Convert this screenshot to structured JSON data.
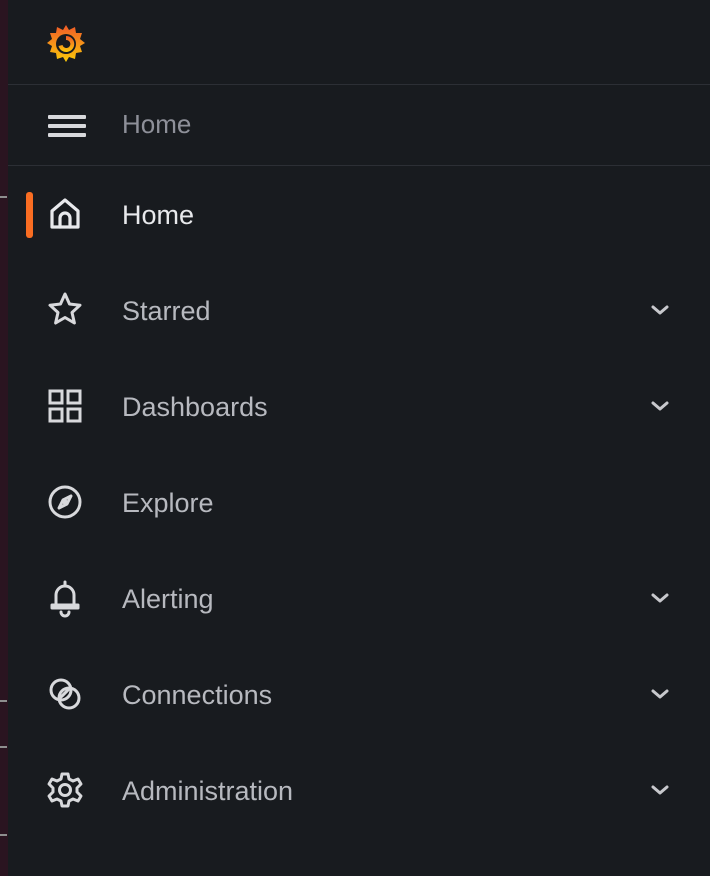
{
  "header": {
    "logo_icon": "grafana-logo"
  },
  "dock": {
    "menu_icon": "hamburger-menu-icon",
    "title": "Home"
  },
  "nav": {
    "items": [
      {
        "label": "Home",
        "icon": "home-icon",
        "active": true,
        "expandable": false
      },
      {
        "label": "Starred",
        "icon": "star-icon",
        "active": false,
        "expandable": true
      },
      {
        "label": "Dashboards",
        "icon": "apps-grid-icon",
        "active": false,
        "expandable": true
      },
      {
        "label": "Explore",
        "icon": "compass-icon",
        "active": false,
        "expandable": false
      },
      {
        "label": "Alerting",
        "icon": "bell-icon",
        "active": false,
        "expandable": true
      },
      {
        "label": "Connections",
        "icon": "connections-icon",
        "active": false,
        "expandable": true
      },
      {
        "label": "Administration",
        "icon": "gear-icon",
        "active": false,
        "expandable": true
      }
    ]
  },
  "colors": {
    "background": "#181b1f",
    "active_indicator": "#f96d22",
    "text_primary": "#e8e9ec",
    "text_secondary": "#b7b9bf",
    "divider": "#2c2f35"
  }
}
